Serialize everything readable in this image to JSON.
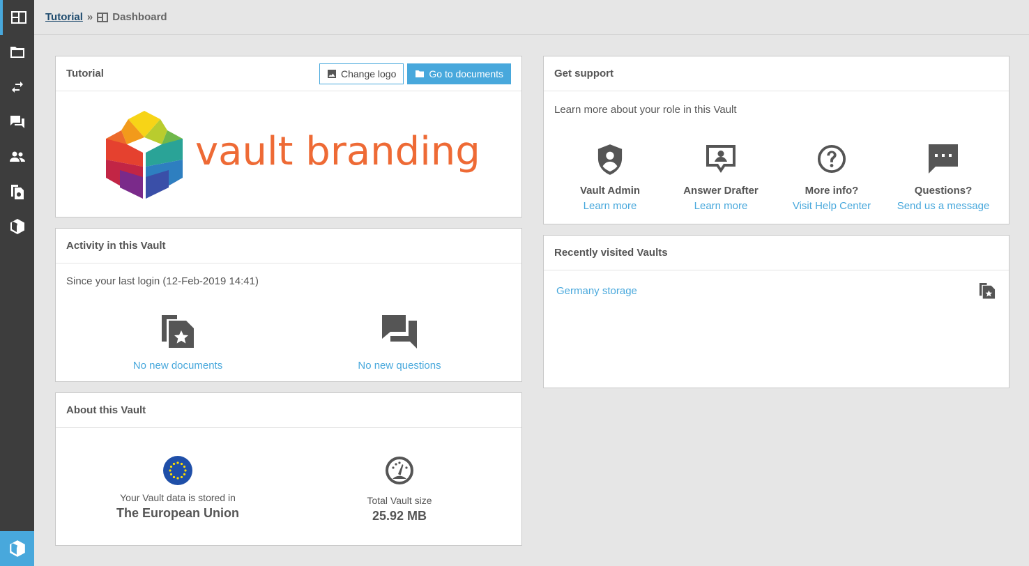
{
  "sidebar": {
    "items": [
      {
        "name": "dashboard",
        "icon": "dashboard-icon",
        "active": true
      },
      {
        "name": "documents",
        "icon": "folder-icon"
      },
      {
        "name": "exchange",
        "icon": "exchange-icon"
      },
      {
        "name": "questions",
        "icon": "chat-icon"
      },
      {
        "name": "users",
        "icon": "users-icon"
      },
      {
        "name": "reports",
        "icon": "report-icon"
      },
      {
        "name": "vaults",
        "icon": "cube-icon"
      }
    ],
    "bottom_icon": "cube-icon"
  },
  "breadcrumb": {
    "root": "Tutorial",
    "separator": "»",
    "current": "Dashboard",
    "current_icon": "dashboard-icon"
  },
  "tutorial_panel": {
    "title": "Tutorial",
    "change_logo_label": "Change logo",
    "go_to_documents_label": "Go to documents",
    "logo_text": "vault branding"
  },
  "activity_panel": {
    "title": "Activity in this Vault",
    "since_text": "Since your last login (12-Feb-2019 14:41)",
    "documents_link": "No new documents",
    "questions_link": "No new questions"
  },
  "about_panel": {
    "title": "About this Vault",
    "storage_label": "Your Vault data is stored in",
    "storage_value": "The European Union",
    "size_label": "Total Vault size",
    "size_value": "25.92 MB"
  },
  "support_panel": {
    "title": "Get support",
    "intro": "Learn more about your role in this Vault",
    "items": [
      {
        "title": "Vault Admin",
        "link": "Learn more",
        "icon": "shield-user-icon"
      },
      {
        "title": "Answer Drafter",
        "link": "Learn more",
        "icon": "answer-drafter-icon"
      },
      {
        "title": "More info?",
        "link": "Visit Help Center",
        "icon": "help-icon"
      },
      {
        "title": "Questions?",
        "link": "Send us a message",
        "icon": "message-icon"
      }
    ]
  },
  "recent_panel": {
    "title": "Recently visited Vaults",
    "items": [
      {
        "name": "Germany storage",
        "icon": "favorite-doc-icon"
      }
    ]
  },
  "colors": {
    "accent": "#48a8dc",
    "sidebar": "#3d3d3d",
    "logo_text": "#ee6a35",
    "eu_blue": "#1f4fa8",
    "eu_star": "#ffdd00"
  }
}
